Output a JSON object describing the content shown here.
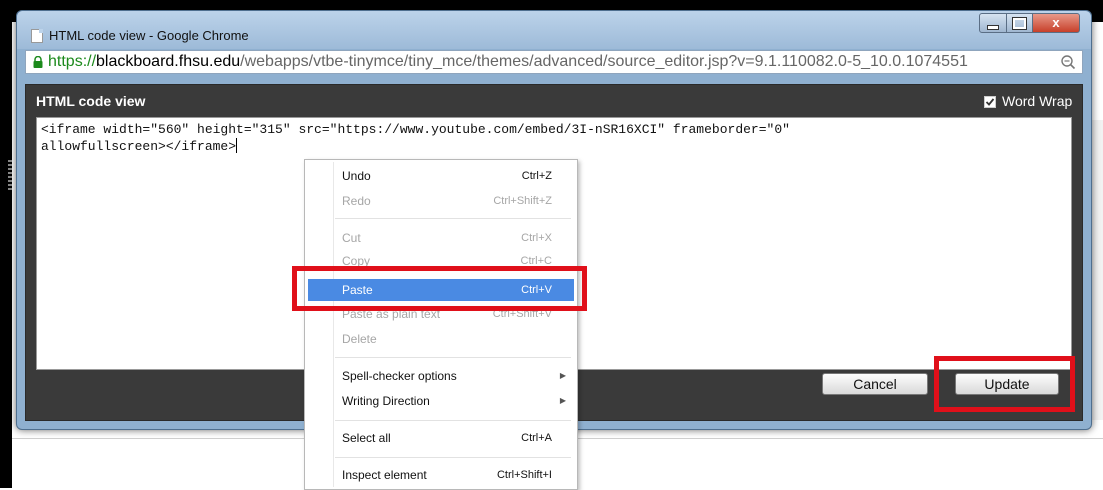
{
  "window": {
    "title": "HTML code view - Google Chrome",
    "url_scheme": "https://",
    "url_host": "blackboard.fhsu.edu",
    "url_path": "/webapps/vtbe-tinymce/tiny_mce/themes/advanced/source_editor.jsp?v=9.1.110082.0-5_10.0.1074551",
    "close_glyph": "x"
  },
  "dialog": {
    "title": "HTML code view",
    "word_wrap_label": "Word Wrap",
    "word_wrap_checked": true,
    "code": "<iframe width=\"560\" height=\"315\" src=\"https://www.youtube.com/embed/3I-nSR16XCI\" frameborder=\"0\"\nallowfullscreen></iframe>",
    "cancel_label": "Cancel",
    "update_label": "Update"
  },
  "context_menu": {
    "undo": {
      "label": "Undo",
      "shortcut": "Ctrl+Z"
    },
    "redo": {
      "label": "Redo",
      "shortcut": "Ctrl+Shift+Z"
    },
    "cut": {
      "label": "Cut",
      "shortcut": "Ctrl+X"
    },
    "copy": {
      "label": "Copy",
      "shortcut": "Ctrl+C"
    },
    "paste": {
      "label": "Paste",
      "shortcut": "Ctrl+V"
    },
    "paste_plain": {
      "label": "Paste as plain text",
      "shortcut": "Ctrl+Shift+V"
    },
    "delete": {
      "label": "Delete"
    },
    "spell": {
      "label": "Spell-checker options"
    },
    "writing_direction": {
      "label": "Writing Direction"
    },
    "select_all": {
      "label": "Select all",
      "shortcut": "Ctrl+A"
    },
    "inspect": {
      "label": "Inspect element",
      "shortcut": "Ctrl+Shift+I"
    }
  },
  "colors": {
    "highlight": "#e0101a",
    "menu_selected": "#4a8ae3",
    "url_scheme": "#1c8a1c",
    "dialog_bg": "#3a3a3a"
  }
}
